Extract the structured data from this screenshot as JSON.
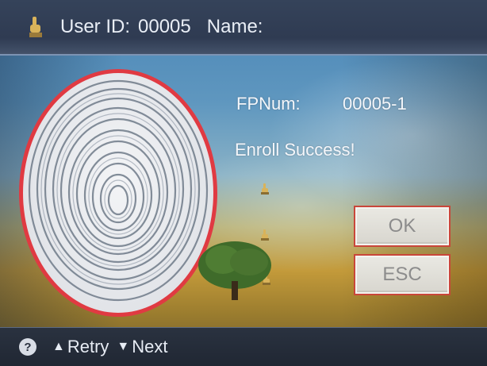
{
  "header": {
    "user_id_label": "User ID:",
    "user_id_value": "00005",
    "name_label": "Name:",
    "icon": "hand-icon"
  },
  "fingerprint": {
    "icon": "fingerprint-icon"
  },
  "info": {
    "fpnum_label": "FPNum:",
    "fpnum_value": "00005-1",
    "status": "Enroll Success!"
  },
  "buttons": {
    "ok_label": "OK",
    "esc_label": "ESC"
  },
  "footer": {
    "help_icon": "question-icon",
    "retry_arrow": "▲",
    "retry_label": "Retry",
    "next_arrow": "▼",
    "next_label": "Next"
  },
  "colors": {
    "header_bg": "#2f3b52",
    "fingerprint_border": "#e03a42",
    "button_bg": "#e3e2dc",
    "button_text": "#8c8c8c",
    "text": "#f4f6fa"
  }
}
